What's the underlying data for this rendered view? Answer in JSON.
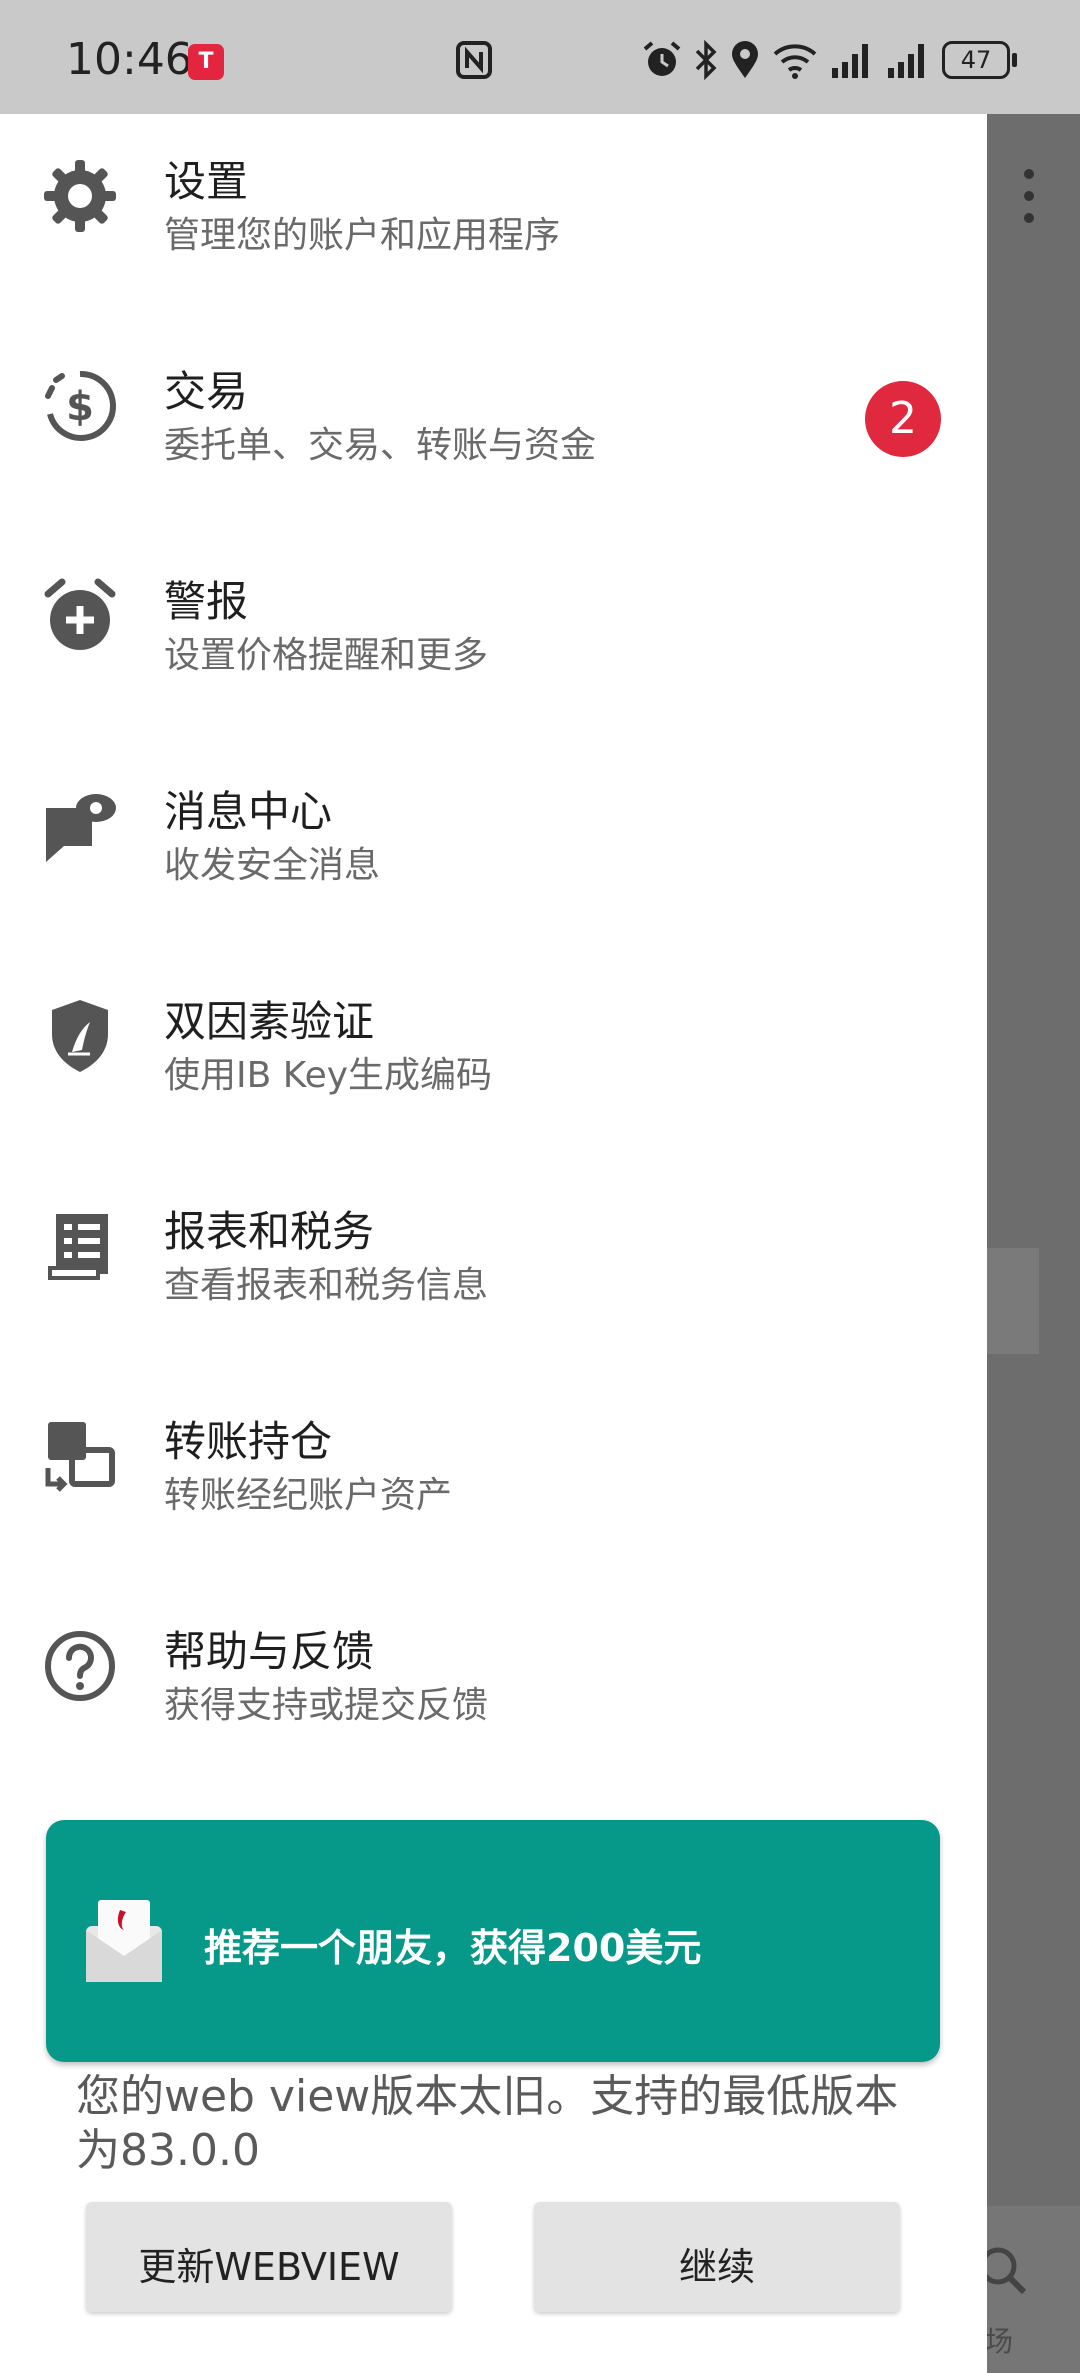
{
  "status_bar": {
    "time": "10:46",
    "battery": "47",
    "notification_icons": [
      "tesla-icon"
    ],
    "system_icons": [
      "nfc-icon",
      "alarm-icon",
      "bluetooth-icon",
      "location-icon",
      "wifi-icon",
      "signal-icon",
      "signal-icon",
      "battery-icon"
    ]
  },
  "menu": {
    "items": [
      {
        "icon": "gear-icon",
        "title": "设置",
        "subtitle": "管理您的账户和应用程序"
      },
      {
        "icon": "dollar-history-icon",
        "title": "交易",
        "subtitle": "委托单、交易、转账与资金",
        "badge": "2"
      },
      {
        "icon": "alarm-add-icon",
        "title": "警报",
        "subtitle": "设置价格提醒和更多"
      },
      {
        "icon": "message-eye-icon",
        "title": "消息中心",
        "subtitle": "收发安全消息"
      },
      {
        "icon": "shield-key-icon",
        "title": "双因素验证",
        "subtitle": "使用IB Key生成编码"
      },
      {
        "icon": "report-icon",
        "title": "报表和税务",
        "subtitle": "查看报表和税务信息"
      },
      {
        "icon": "transfer-icon",
        "title": "转账持仓",
        "subtitle": "转账经纪账户资产"
      },
      {
        "icon": "help-icon",
        "title": "帮助与反馈",
        "subtitle": "获得支持或提交反馈"
      }
    ]
  },
  "promo": {
    "icon": "envelope-icon",
    "label": "推荐一个朋友，获得200美元"
  },
  "webview_warning": {
    "message": "您的web view版本太旧。支持的最低版本为83.0.0",
    "update_button": "更新WEBVIEW",
    "continue_button": "继续"
  },
  "background": {
    "partial_label": "场"
  },
  "colors": {
    "accent": "#06998a",
    "badge": "#e0283f",
    "status_bar": "#c9c9c9"
  }
}
